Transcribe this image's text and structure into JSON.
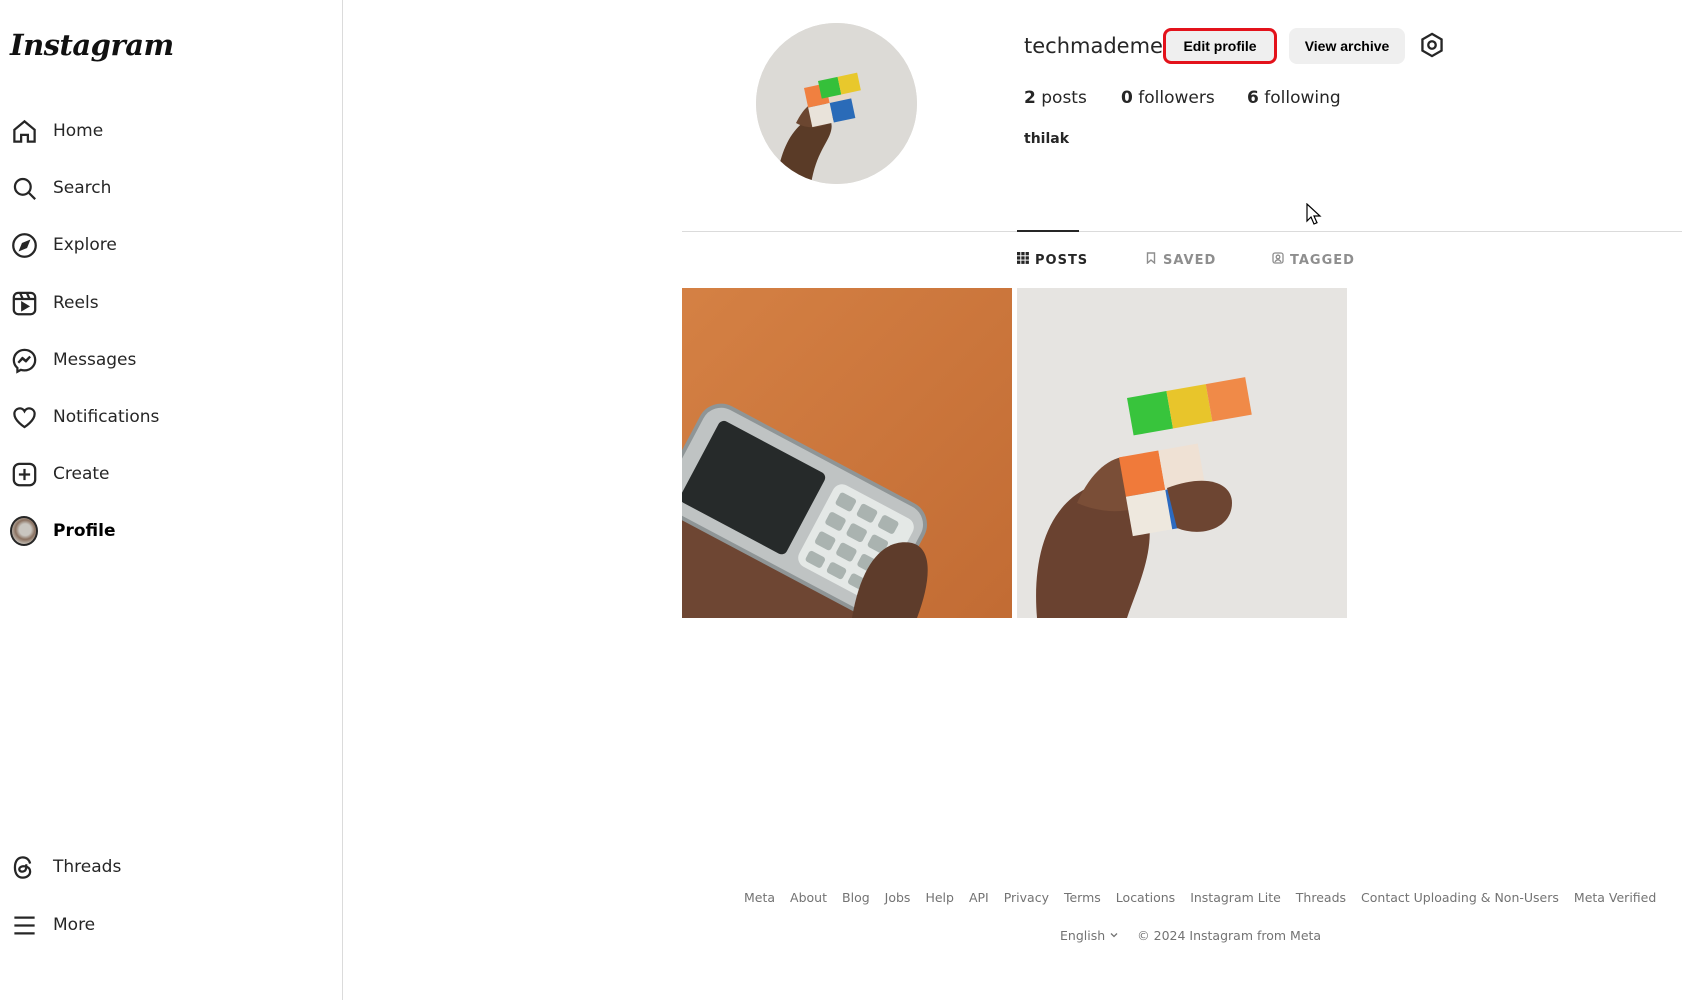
{
  "app": {
    "logo_text": "Instagram"
  },
  "sidebar": {
    "items": [
      {
        "label": "Home",
        "icon": "home-icon"
      },
      {
        "label": "Search",
        "icon": "search-icon"
      },
      {
        "label": "Explore",
        "icon": "compass-icon"
      },
      {
        "label": "Reels",
        "icon": "reels-icon"
      },
      {
        "label": "Messages",
        "icon": "messenger-icon"
      },
      {
        "label": "Notifications",
        "icon": "heart-icon"
      },
      {
        "label": "Create",
        "icon": "plus-square-icon"
      },
      {
        "label": "Profile",
        "icon": "avatar",
        "active": true
      }
    ],
    "bottom_items": [
      {
        "label": "Threads",
        "icon": "threads-icon"
      },
      {
        "label": "More",
        "icon": "menu-icon"
      }
    ]
  },
  "profile": {
    "username": "techmademe",
    "edit_button": "Edit profile",
    "archive_button": "View archive",
    "settings_icon": "gear-icon",
    "stats": {
      "posts_count": "2",
      "posts_label": "posts",
      "followers_count": "0",
      "followers_label": "followers",
      "following_count": "6",
      "following_label": "following"
    },
    "full_name": "thilak",
    "highlight_color": "#e3121b"
  },
  "tabs": [
    {
      "label": "POSTS",
      "icon": "grid-icon",
      "active": true
    },
    {
      "label": "SAVED",
      "icon": "bookmark-icon"
    },
    {
      "label": "TAGGED",
      "icon": "tag-icon"
    }
  ],
  "posts": [
    {
      "subject": "phone-photo"
    },
    {
      "subject": "cube-photo"
    }
  ],
  "footer": {
    "links": [
      "Meta",
      "About",
      "Blog",
      "Jobs",
      "Help",
      "API",
      "Privacy",
      "Terms",
      "Locations",
      "Instagram Lite",
      "Threads",
      "Contact Uploading & Non-Users",
      "Meta Verified"
    ],
    "language": "English",
    "copyright": "© 2024 Instagram from Meta"
  }
}
